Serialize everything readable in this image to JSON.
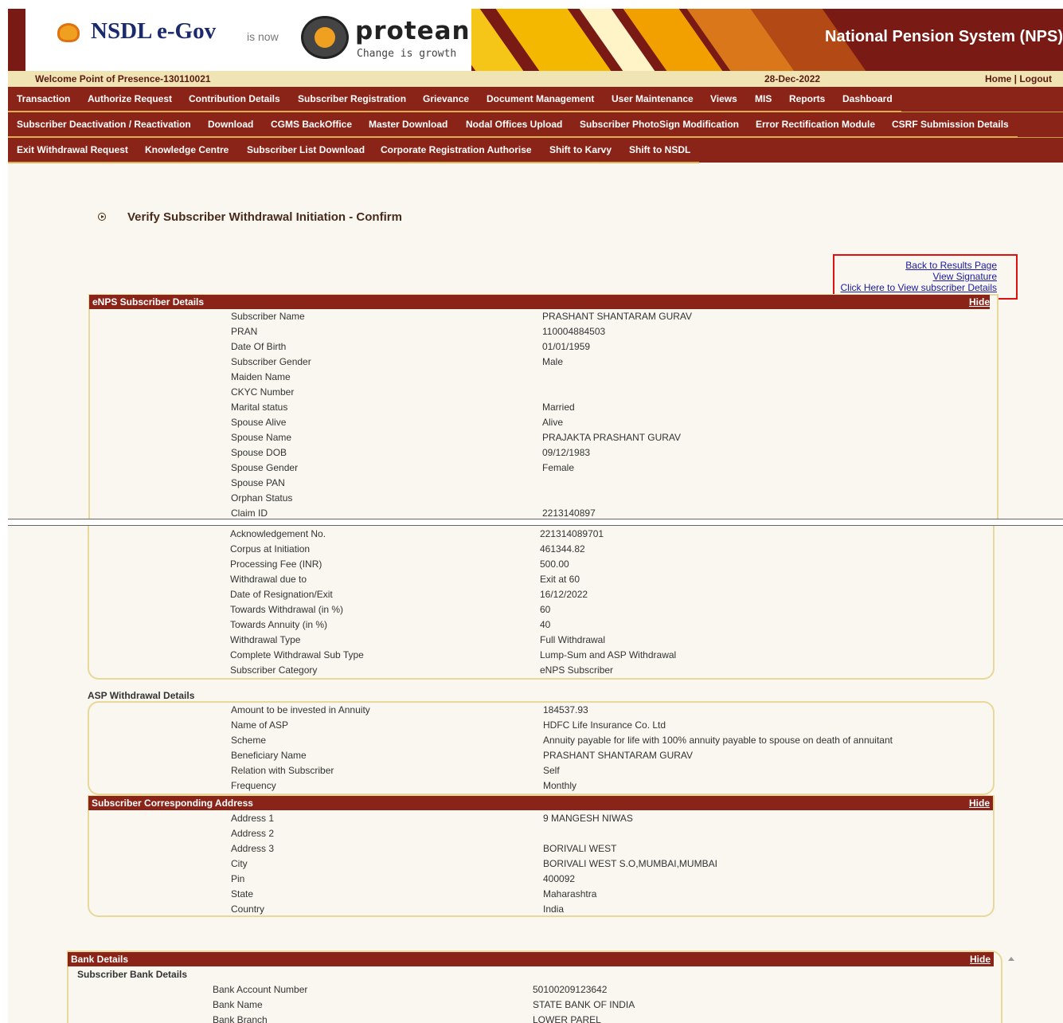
{
  "header": {
    "brand_nsdl": "NSDL e-Gov",
    "brand_isnow": "is now",
    "brand_protean": "protean",
    "tagline": "Change is growth",
    "system_title": "National Pension System (NPS)"
  },
  "welcome": {
    "text": "Welcome Point of Presence-130110021",
    "date": "28-Dec-2022",
    "links": "Home | Logout"
  },
  "menu": {
    "row1": [
      "Transaction",
      "Authorize Request",
      "Contribution Details",
      "Subscriber Registration",
      "Grievance",
      "Document Management",
      "User Maintenance",
      "Views",
      "MIS",
      "Reports",
      "Dashboard"
    ],
    "row2": [
      "Subscriber Deactivation / Reactivation",
      "Download",
      "CGMS BackOffice",
      "Master Download",
      "Nodal Offices Upload",
      "Subscriber PhotoSign Modification",
      "Error Rectification Module",
      "CSRF Submission Details"
    ],
    "row3": [
      "Exit Withdrawal Request",
      "Knowledge Centre",
      "Subscriber List Download",
      "Corporate Registration Authorise",
      "Shift to Karvy",
      "Shift to NSDL"
    ]
  },
  "page": {
    "title": "Verify Subscriber Withdrawal Initiation - Confirm",
    "links": [
      "Back to Results Page",
      "View Signature",
      "Click Here to View subscriber Details"
    ],
    "hide_label": "Hide"
  },
  "enps": {
    "heading": "eNPS Subscriber Details",
    "rows_top": [
      [
        "Subscriber Name",
        "PRASHANT SHANTARAM GURAV"
      ],
      [
        "PRAN",
        "110004884503"
      ],
      [
        "Date Of Birth",
        "01/01/1959"
      ],
      [
        "Subscriber Gender",
        "Male"
      ],
      [
        "Maiden Name",
        ""
      ],
      [
        "CKYC Number",
        ""
      ],
      [
        "Marital status",
        "Married"
      ],
      [
        "Spouse Alive",
        "Alive"
      ],
      [
        "Spouse Name",
        "PRAJAKTA PRASHANT GURAV"
      ],
      [
        "Spouse DOB",
        "09/12/1983"
      ],
      [
        "Spouse Gender",
        "Female"
      ],
      [
        "Spouse PAN",
        ""
      ],
      [
        "Orphan Status",
        ""
      ],
      [
        "Claim ID",
        "2213140897"
      ]
    ],
    "rows_bottom": [
      [
        "Acknowledgement No.",
        "221314089701"
      ],
      [
        "Corpus at Initiation",
        "461344.82"
      ],
      [
        "Processing Fee (INR)",
        "500.00"
      ],
      [
        "Withdrawal due to",
        "Exit at 60"
      ],
      [
        "Date of Resignation/Exit",
        "16/12/2022"
      ],
      [
        "Towards Withdrawal (in %)",
        "60"
      ],
      [
        "Towards Annuity (in %)",
        "40"
      ],
      [
        "Withdrawal Type",
        "Full Withdrawal"
      ],
      [
        "Complete Withdrawal Sub Type",
        "Lump-Sum and ASP Withdrawal"
      ],
      [
        "Subscriber Category",
        "eNPS Subscriber"
      ]
    ]
  },
  "asp": {
    "heading": "ASP Withdrawal Details",
    "rows": [
      [
        "Amount to be invested in Annuity",
        "184537.93"
      ],
      [
        "Name of ASP",
        "HDFC Life Insurance Co. Ltd"
      ],
      [
        "Scheme",
        "Annuity payable for life with 100% annuity payable to spouse on death of annuitant"
      ],
      [
        "Beneficiary Name",
        "PRASHANT SHANTARAM GURAV"
      ],
      [
        "Relation with Subscriber",
        "Self"
      ],
      [
        "Frequency",
        "Monthly"
      ]
    ]
  },
  "address": {
    "heading": "Subscriber Corresponding Address",
    "rows": [
      [
        "Address 1",
        "9 MANGESH NIWAS"
      ],
      [
        "Address 2",
        ""
      ],
      [
        "Address 3",
        "BORIVALI WEST"
      ],
      [
        "City",
        "BORIVALI WEST S.O,MUMBAI,MUMBAI"
      ],
      [
        "Pin",
        "400092"
      ],
      [
        "State",
        "Maharashtra"
      ],
      [
        "Country",
        "India"
      ]
    ]
  },
  "bank": {
    "heading": "Bank Details",
    "subheading": "Subscriber Bank Details",
    "rows": [
      [
        "Bank Account Number",
        "50100209123642"
      ],
      [
        "Bank Name",
        "STATE BANK OF INDIA"
      ],
      [
        "Bank Branch",
        "LOWER PAREL"
      ]
    ]
  }
}
